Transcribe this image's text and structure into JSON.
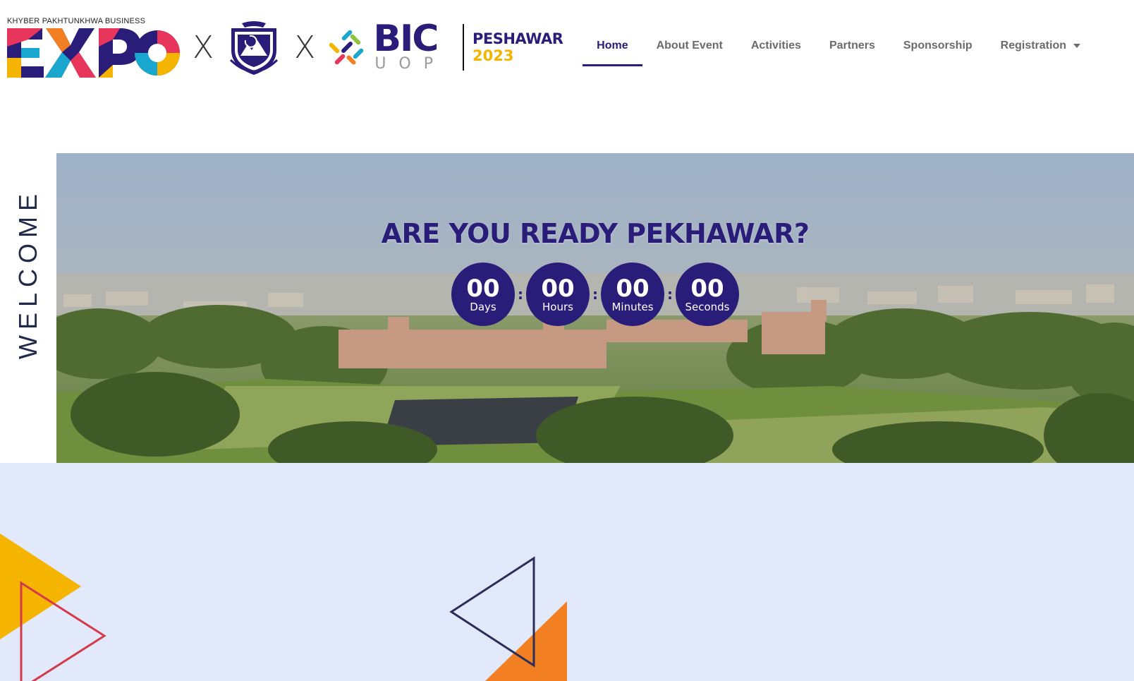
{
  "header": {
    "expo_subtitle": "KHYBER PAKHTUNKHWA BUSINESS",
    "expo_word": "EXPO",
    "separator": "X",
    "bic_main": "BIC",
    "bic_sub": "UOP",
    "city": "PESHAWAR",
    "year": "2023"
  },
  "nav": {
    "items": [
      {
        "label": "Home",
        "active": true
      },
      {
        "label": "About Event"
      },
      {
        "label": "Activities"
      },
      {
        "label": "Partners"
      },
      {
        "label": "Sponsorship"
      },
      {
        "label": "Registration",
        "dropdown": true
      }
    ]
  },
  "welcome": "WELCOME",
  "hero": {
    "title": "ARE YOU READY PEKHAWAR?",
    "countdown": [
      {
        "value": "00",
        "label": "Days"
      },
      {
        "value": "00",
        "label": "Hours"
      },
      {
        "value": "00",
        "label": "Minutes"
      },
      {
        "value": "00",
        "label": "Seconds"
      }
    ],
    "separator": ":"
  },
  "colors": {
    "brand_purple": "#2a1d79",
    "accent_yellow": "#f4b400",
    "accent_orange": "#f28022",
    "accent_red": "#d43a4a",
    "lower_bg": "#e1e9fb"
  }
}
